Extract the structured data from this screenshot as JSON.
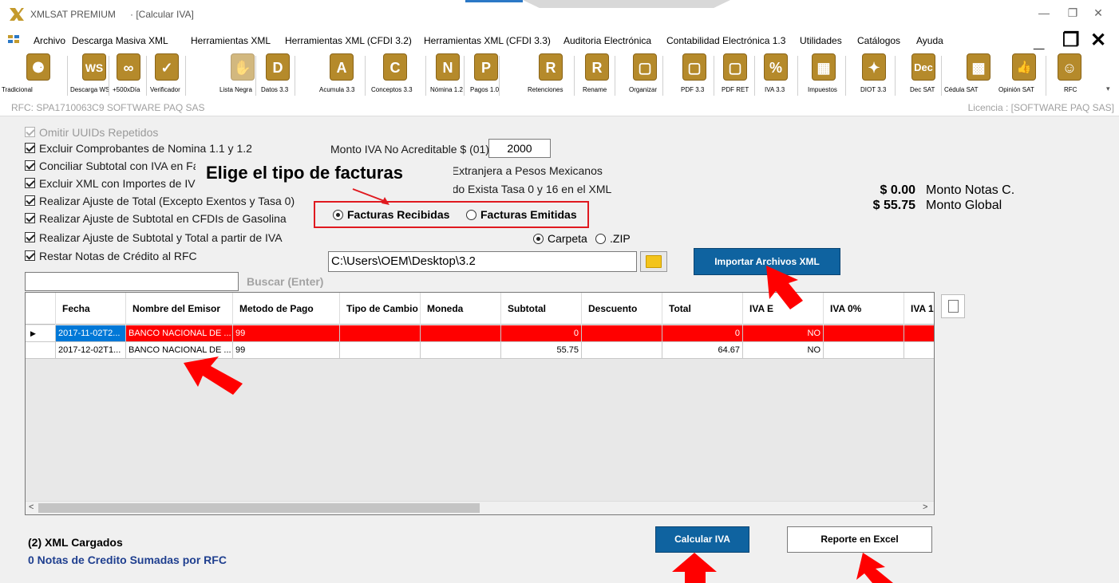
{
  "window": {
    "app_name": "XMLSAT PREMIUM",
    "subtitle": "· [Calcular IVA]"
  },
  "menu": [
    "Archivo",
    "Descarga Masiva XML",
    "Herramientas XML",
    "Herramientas XML (CFDI 3.2)",
    "Herramientas XML (CFDI 3.3)",
    "Auditoria Electrónica",
    "Contabilidad Electrónica 1.3",
    "Utilidades",
    "Catálogos",
    "Ayuda"
  ],
  "toolbar": [
    {
      "label": "Tradicional",
      "glyph": "⚈"
    },
    {
      "label": "Descarga WS",
      "glyph": "WS"
    },
    {
      "label": "+500xDía",
      "glyph": "∞"
    },
    {
      "label": "Verificador",
      "glyph": "✓"
    },
    {
      "label": "Lista Negra",
      "glyph": "✋"
    },
    {
      "label": "Datos 3.3",
      "glyph": "D"
    },
    {
      "label": "Acumula 3.3",
      "glyph": "A"
    },
    {
      "label": "Conceptos 3.3",
      "glyph": "C"
    },
    {
      "label": "Nómina 1.2",
      "glyph": "N"
    },
    {
      "label": "Pagos 1.0",
      "glyph": "P"
    },
    {
      "label": "Retenciones",
      "glyph": "R"
    },
    {
      "label": "Rename",
      "glyph": "R"
    },
    {
      "label": "Organizar",
      "glyph": "▢"
    },
    {
      "label": "PDF 3.3",
      "glyph": "▢"
    },
    {
      "label": "PDF RET",
      "glyph": "▢"
    },
    {
      "label": "IVA 3.3",
      "glyph": "%"
    },
    {
      "label": "Impuestos",
      "glyph": "▦"
    },
    {
      "label": "DIOT 3.3",
      "glyph": "✦"
    },
    {
      "label": "Dec SAT",
      "glyph": "Dec"
    },
    {
      "label": "Cédula SAT",
      "glyph": "▩"
    },
    {
      "label": "Opinión SAT",
      "glyph": "👍"
    },
    {
      "label": "RFC",
      "glyph": "☺"
    }
  ],
  "rfc_line": "RFC: SPA1710063C9 SOFTWARE PAQ SAS",
  "license": "Licencia : [SOFTWARE PAQ SAS]",
  "options": {
    "omitir": "Omitir UUIDs Repetidos",
    "excluir_nomina": "Excluir Comprobantes de Nomina 1.1 y 1.2",
    "conciliar": "Conciliar Subtotal con IVA en Fa",
    "excluir_xml": "Excluir XML con Importes de IV",
    "ajuste_total": "Realizar Ajuste de Total (Excepto Exentos y Tasa 0)",
    "ajuste_subtotal": "Realizar Ajuste de Subtotal en CFDIs de Gasolina",
    "ajuste_iva": "Realizar Ajuste de Subtotal y Total a partir de IVA",
    "restar_notas": "Restar Notas de Crédito al RFC"
  },
  "monto_label": "Monto IVA No Acreditable $ (01)",
  "monto_value": "2000",
  "moneda_text": "la Extranjera a Pesos Mexicanos",
  "tasa_text": "ando Exista Tasa 0 y 16 en el XML",
  "callout": "Elige el tipo de facturas",
  "radios": {
    "recibidas": "Facturas Recibidas",
    "emitidas": "Facturas Emitidas",
    "carpeta": "Carpeta",
    "zip": ".ZIP"
  },
  "path_value": "C:\\Users\\OEM\\Desktop\\3.2",
  "btn_importar": "Importar Archivos  XML",
  "search_label": "Buscar (Enter)",
  "totals": {
    "notas_amount": "$ 0.00",
    "notas_label": "Monto Notas C.",
    "global_amount": "$ 55.75",
    "global_label": "Monto Global"
  },
  "grid": {
    "headers": [
      "Fecha",
      "Nombre del Emisor",
      "Metodo de Pago",
      "Tipo de Cambio",
      "Moneda",
      "Subtotal",
      "Descuento",
      "Total",
      "IVA E",
      "IVA 0%",
      "IVA 1"
    ],
    "rows": [
      [
        "2017-11-02T2...",
        "BANCO NACIONAL DE ...",
        "99",
        "",
        "",
        "0",
        "",
        "0",
        "NO",
        "",
        ""
      ],
      [
        "2017-12-02T1...",
        "BANCO NACIONAL DE ...",
        "99",
        "",
        "",
        "55.75",
        "",
        "64.67",
        "NO",
        "",
        ""
      ]
    ]
  },
  "status": {
    "loaded": "(2) XML Cargados",
    "notas": "0 Notas de Credito Sumadas por RFC"
  },
  "btn_calcular": "Calcular IVA",
  "btn_reporte": "Reporte en Excel",
  "colors": {
    "accent_blue": "#0f63a0",
    "highlight_red": "#ff0000",
    "icon_gold": "#b58a2b"
  }
}
